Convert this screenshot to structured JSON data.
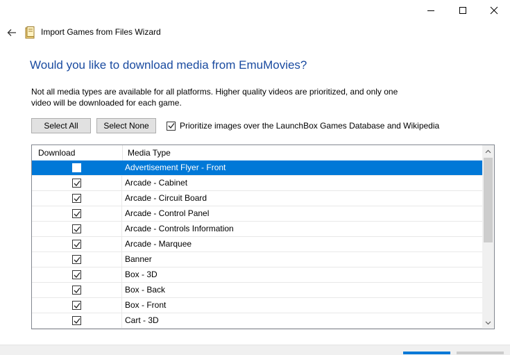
{
  "window": {
    "title": "Import Games from Files Wizard",
    "controls": [
      "minimize-icon",
      "maximize-icon",
      "close-icon"
    ]
  },
  "page": {
    "heading": "Would you like to download media from EmuMovies?",
    "description": "Not all media types are available for all platforms. Higher quality videos are prioritized, and only one video will be downloaded for each game."
  },
  "actions": {
    "select_all": "Select All",
    "select_none": "Select None",
    "prioritize_label": "Prioritize images over the LaunchBox Games Database and Wikipedia",
    "prioritize_checked": true
  },
  "table": {
    "columns": [
      "Download",
      "Media Type"
    ],
    "rows": [
      {
        "checked": true,
        "media_type": "Advertisement Flyer - Front",
        "selected": true
      },
      {
        "checked": true,
        "media_type": "Arcade - Cabinet"
      },
      {
        "checked": true,
        "media_type": "Arcade - Circuit Board"
      },
      {
        "checked": true,
        "media_type": "Arcade - Control Panel"
      },
      {
        "checked": true,
        "media_type": "Arcade - Controls Information"
      },
      {
        "checked": true,
        "media_type": "Arcade - Marquee"
      },
      {
        "checked": true,
        "media_type": "Banner"
      },
      {
        "checked": true,
        "media_type": "Box - 3D"
      },
      {
        "checked": true,
        "media_type": "Box - Back"
      },
      {
        "checked": true,
        "media_type": "Box - Front"
      },
      {
        "checked": true,
        "media_type": "Cart - 3D"
      }
    ]
  },
  "colors": {
    "heading": "#1a4ba0",
    "selection": "#0078d7"
  }
}
